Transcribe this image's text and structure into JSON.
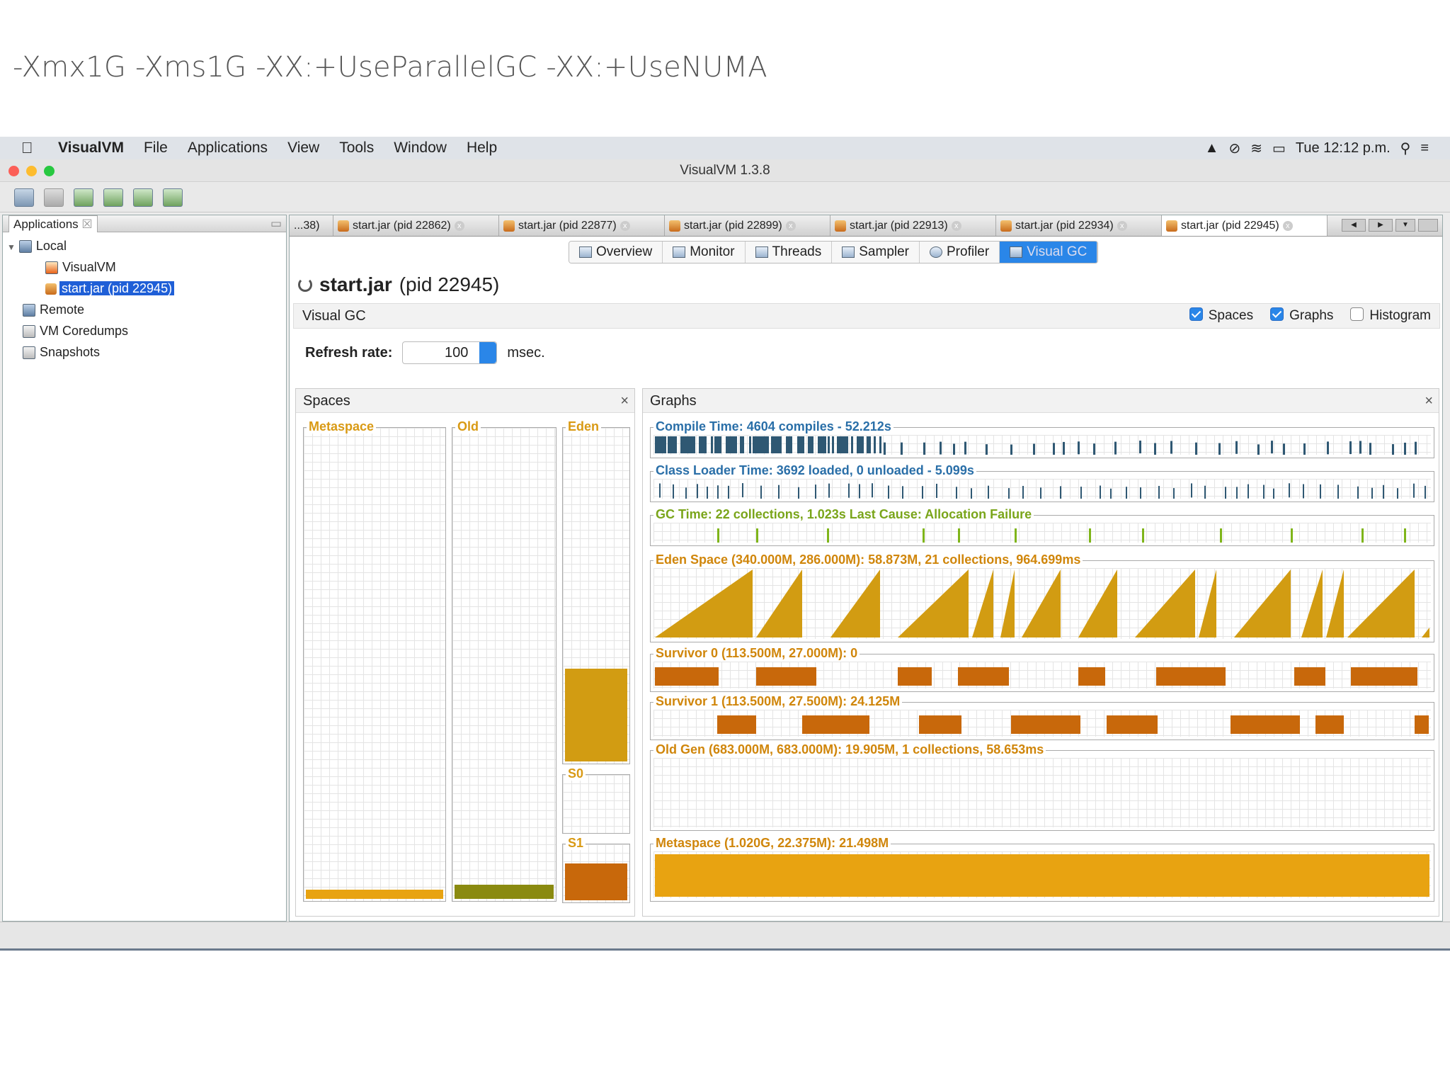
{
  "slide": {
    "title": "-Xmx1G -Xms1G -XX:+UseParallelGC -XX:+UseNUMA"
  },
  "menubar": {
    "app": "VisualVM",
    "items": [
      "File",
      "Applications",
      "View",
      "Tools",
      "Window",
      "Help"
    ],
    "clock": "Tue 12:12 p.m."
  },
  "window": {
    "title": "VisualVM 1.3.8"
  },
  "left": {
    "tab": "Applications",
    "tree": {
      "local": "Local",
      "visualvm": "VisualVM",
      "selected": "start.jar (pid 22945)",
      "remote": "Remote",
      "coredumps": "VM Coredumps",
      "snapshots": "Snapshots"
    }
  },
  "tabs": [
    {
      "label": "...38)"
    },
    {
      "label": "start.jar (pid 22862)"
    },
    {
      "label": "start.jar (pid 22877)"
    },
    {
      "label": "start.jar (pid 22899)"
    },
    {
      "label": "start.jar (pid 22913)"
    },
    {
      "label": "start.jar (pid 22934)"
    },
    {
      "label": "start.jar (pid 22945)"
    }
  ],
  "subtabs": [
    "Overview",
    "Monitor",
    "Threads",
    "Sampler",
    "Profiler",
    "Visual GC"
  ],
  "heading": {
    "name": "start.jar",
    "pid": "(pid 22945)"
  },
  "visualgc": {
    "title": "Visual GC",
    "opt_spaces": "Spaces",
    "opt_graphs": "Graphs",
    "opt_histogram": "Histogram",
    "refresh_label": "Refresh rate:",
    "refresh_value": "100",
    "refresh_unit": "msec."
  },
  "spaces": {
    "title": "Spaces",
    "metaspace": "Metaspace",
    "old": "Old",
    "eden": "Eden",
    "s0": "S0",
    "s1": "S1",
    "levels": {
      "metaspace": 0.02,
      "old": 0.03,
      "eden": 0.28,
      "s0": 0.0,
      "s1": 0.68
    },
    "colors": {
      "metaspace": "#e8a311",
      "old": "#8a8a10",
      "eden": "#d29c12",
      "s0": "#c8680b",
      "s1": "#c8680b"
    }
  },
  "graphs": {
    "title": "Graphs",
    "compile": "Compile Time: 4604 compiles - 52.212s",
    "classloader": "Class Loader Time: 3692 loaded, 0 unloaded - 5.099s",
    "gc": "GC Time: 22 collections, 1.023s  Last Cause: Allocation Failure",
    "eden": "Eden Space (340.000M, 286.000M): 58.873M, 21 collections, 964.699ms",
    "survivor0": "Survivor 0 (113.500M, 27.000M): 0",
    "survivor1": "Survivor 1 (113.500M, 27.500M): 24.125M",
    "oldgen": "Old Gen (683.000M, 683.000M): 19.905M, 1 collections, 58.653ms",
    "metaspace": "Metaspace (1.020G, 22.375M): 21.498M",
    "colors": {
      "compile": "#2f5873",
      "classloader": "#2f5873",
      "gc": "#7fb51a",
      "eden": "#d29c12",
      "survivor": "#c8680b",
      "metaspace": "#e8a311",
      "label_blue": "#2a6fa8",
      "label_orange": "#d0860b"
    }
  }
}
